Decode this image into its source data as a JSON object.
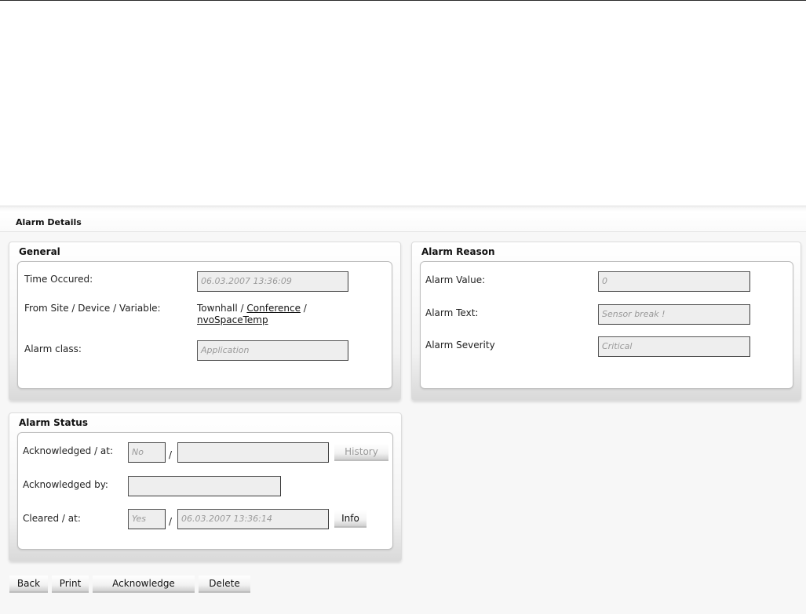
{
  "page_title": "Alarm Details",
  "general": {
    "title": "General",
    "time_label": "Time Occured:",
    "time_value": "06.03.2007 13:36:09",
    "from_label": "From Site / Device / Variable:",
    "site": "Townhall",
    "separator": "/",
    "device": "Conference",
    "variable": "nvoSpaceTemp",
    "class_label": "Alarm class:",
    "class_value": "Application"
  },
  "reason": {
    "title": "Alarm Reason",
    "value_label": "Alarm Value:",
    "value": "0",
    "text_label": "Alarm Text:",
    "text": "Sensor break !",
    "severity_label": "Alarm Severity",
    "severity": "Critical"
  },
  "status": {
    "title": "Alarm Status",
    "ack_label": "Acknowledged / at:",
    "ack_value": "No",
    "ack_at": "",
    "slash": "/",
    "history_label": "History",
    "ackby_label": "Acknowledged by:",
    "ackby_value": "",
    "cleared_label": "Cleared / at:",
    "cleared_value": "Yes",
    "cleared_at": "06.03.2007 13:36:14",
    "info_label": "Info"
  },
  "actions": {
    "back": "Back",
    "print": "Print",
    "acknowledge": "Acknowledge",
    "delete": "Delete"
  }
}
